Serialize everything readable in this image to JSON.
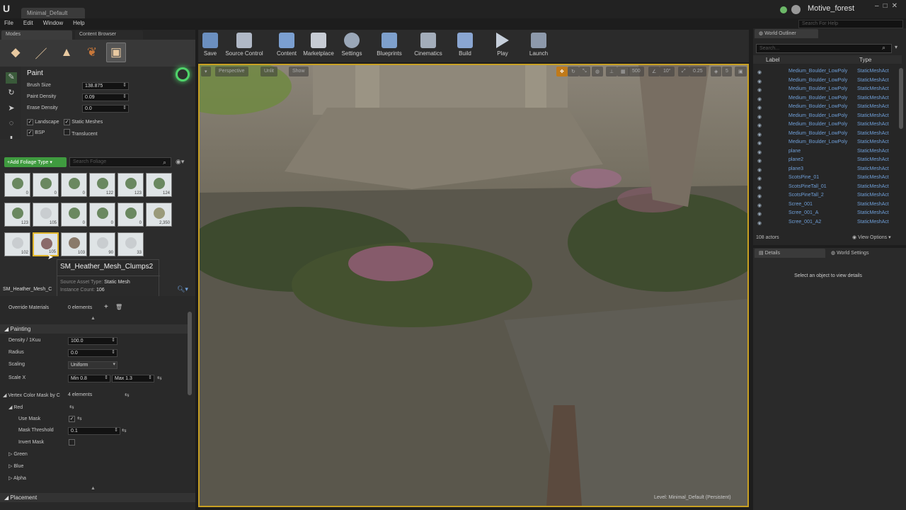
{
  "window": {
    "doc_tab": "Minimal_Default",
    "project": "Motive_forest",
    "search_help_placeholder": "Search For Help",
    "min": "–",
    "max": "□",
    "close": "✕"
  },
  "menu": [
    "File",
    "Edit",
    "Window",
    "Help"
  ],
  "left_tabs": {
    "modes": "Modes",
    "content_browser": "Content Browser"
  },
  "paint": {
    "title": "Paint",
    "brush_size_label": "Brush Size",
    "brush_size": "138.875",
    "paint_density_label": "Paint Density",
    "paint_density": "0.09",
    "erase_density_label": "Erase Density",
    "erase_density": "0.0",
    "landscape": "Landscape",
    "static_meshes": "Static Meshes",
    "bsp": "BSP",
    "translucent": "Translucent"
  },
  "foliage": {
    "add_button": "+Add Foliage Type ▾",
    "search_placeholder": "Search Foliage",
    "thumbs": [
      {
        "count": "0"
      },
      {
        "count": "0"
      },
      {
        "count": "0"
      },
      {
        "count": "122"
      },
      {
        "count": "123"
      },
      {
        "count": "124"
      },
      {
        "count": "123"
      },
      {
        "count": "105"
      },
      {
        "count": "0"
      },
      {
        "count": "0"
      },
      {
        "count": "0"
      },
      {
        "count": "2,350"
      },
      {
        "count": "102"
      },
      {
        "count": "105"
      },
      {
        "count": "103"
      },
      {
        "count": "90"
      },
      {
        "count": "33"
      }
    ],
    "tooltip_title": "SM_Heather_Mesh_Clumps2",
    "tooltip_src_label": "Source Asset Type:",
    "tooltip_src": "Static Mesh",
    "tooltip_inst_label": "Instance Count:",
    "tooltip_inst": "106",
    "selected_name": "SM_Heather_Mesh_C"
  },
  "details_left": {
    "override_materials": "Override Materials",
    "override_count": "0 elements",
    "painting": "Painting",
    "density_label": "Density / 1Kuu",
    "density": "100.0",
    "radius_label": "Radius",
    "radius": "0.0",
    "scaling_label": "Scaling",
    "scaling": "Uniform",
    "scalex_label": "Scale X",
    "scalex_min": "Min  0.8",
    "scalex_max": "Max  1.3",
    "vcm_label": "Vertex Color Mask by C",
    "vcm_count": "4 elements",
    "red": "Red",
    "use_mask": "Use Mask",
    "mask_threshold": "Mask Threshold",
    "mask_threshold_val": "0.1",
    "invert_mask": "Invert Mask",
    "green": "Green",
    "blue": "Blue",
    "alpha": "Alpha",
    "placement": "Placement"
  },
  "toolbar": [
    "Save",
    "Source Control",
    "Content",
    "Marketplace",
    "Settings",
    "Blueprints",
    "Cinematics",
    "Build",
    "Play",
    "Launch"
  ],
  "viewport": {
    "perspective": "Perspective",
    "unlit": "Unlit",
    "show": "Show",
    "grid": "500",
    "rot": "10°",
    "scale": "0.25",
    "cam": "5",
    "level_label": "Level:",
    "level": "Minimal_Default (Persistent)"
  },
  "outliner": {
    "tab": "World Outliner",
    "search_placeholder": "Search...",
    "col_label": "Label",
    "col_type": "Type",
    "rows": [
      {
        "name": "Medium_Boulder_LowPoly",
        "type": "StaticMeshAct"
      },
      {
        "name": "Medium_Boulder_LowPoly",
        "type": "StaticMeshAct"
      },
      {
        "name": "Medium_Boulder_LowPoly",
        "type": "StaticMeshAct"
      },
      {
        "name": "Medium_Boulder_LowPoly",
        "type": "StaticMeshAct"
      },
      {
        "name": "Medium_Boulder_LowPoly",
        "type": "StaticMeshAct"
      },
      {
        "name": "Medium_Boulder_LowPoly",
        "type": "StaticMeshAct"
      },
      {
        "name": "Medium_Boulder_LowPoly",
        "type": "StaticMeshAct"
      },
      {
        "name": "Medium_Boulder_LowPoly",
        "type": "StaticMeshAct"
      },
      {
        "name": "Medium_Boulder_LowPoly",
        "type": "StaticMeshAct"
      },
      {
        "name": "plane",
        "type": "StaticMeshAct"
      },
      {
        "name": "plane2",
        "type": "StaticMeshAct"
      },
      {
        "name": "plane3",
        "type": "StaticMeshAct"
      },
      {
        "name": "ScotsPine_01",
        "type": "StaticMeshAct"
      },
      {
        "name": "ScotsPineTall_01",
        "type": "StaticMeshAct"
      },
      {
        "name": "ScotsPineTall_2",
        "type": "StaticMeshAct"
      },
      {
        "name": "Scree_001",
        "type": "StaticMeshAct"
      },
      {
        "name": "Scree_001_A",
        "type": "StaticMeshAct"
      },
      {
        "name": "Scree_001_A2",
        "type": "StaticMeshAct"
      }
    ],
    "actors": "108 actors",
    "view_options": "View Options ▾"
  },
  "details_right": {
    "tab_details": "Details",
    "tab_world": "World Settings",
    "empty": "Select an object to view details"
  }
}
